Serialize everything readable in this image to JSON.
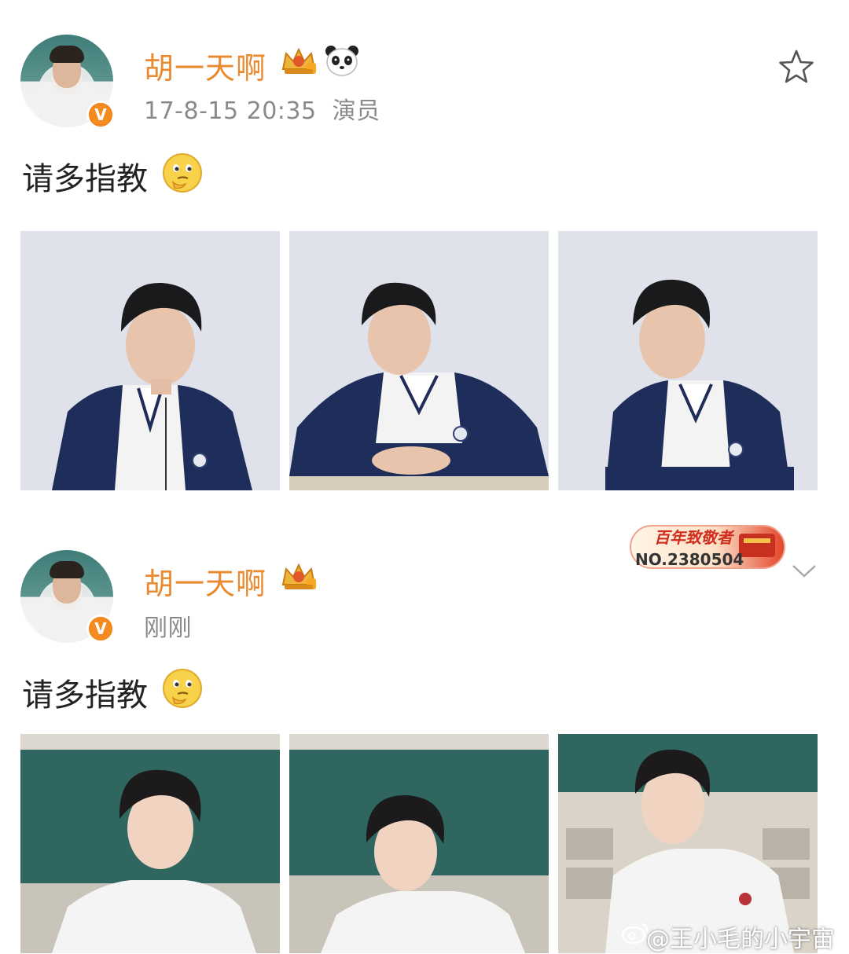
{
  "posts": [
    {
      "author": "胡一天啊",
      "timestamp": "17-8-15 20:35",
      "source": "演员",
      "text": "请多指教",
      "emoji": "thinking-face-emoji",
      "badges": [
        "crown-level-badge",
        "panda-badge"
      ],
      "verified_badge": "V"
    },
    {
      "author": "胡一天啊",
      "timestamp": "刚刚",
      "text": "请多指教",
      "emoji": "thinking-face-emoji",
      "badges": [
        "crown-level-badge"
      ],
      "verified_badge": "V"
    }
  ],
  "medal": {
    "title": "百年致敬者",
    "number": "NO.2380504"
  },
  "icons": {
    "favorite": "star-outline-icon",
    "expand": "chevron-down-icon"
  },
  "watermark": "@王小毛的小宇宙",
  "colors": {
    "author_name": "#ea8a2f",
    "meta_text": "#8a8a8a",
    "body_text": "#222222",
    "verified": "#f58a1f"
  }
}
